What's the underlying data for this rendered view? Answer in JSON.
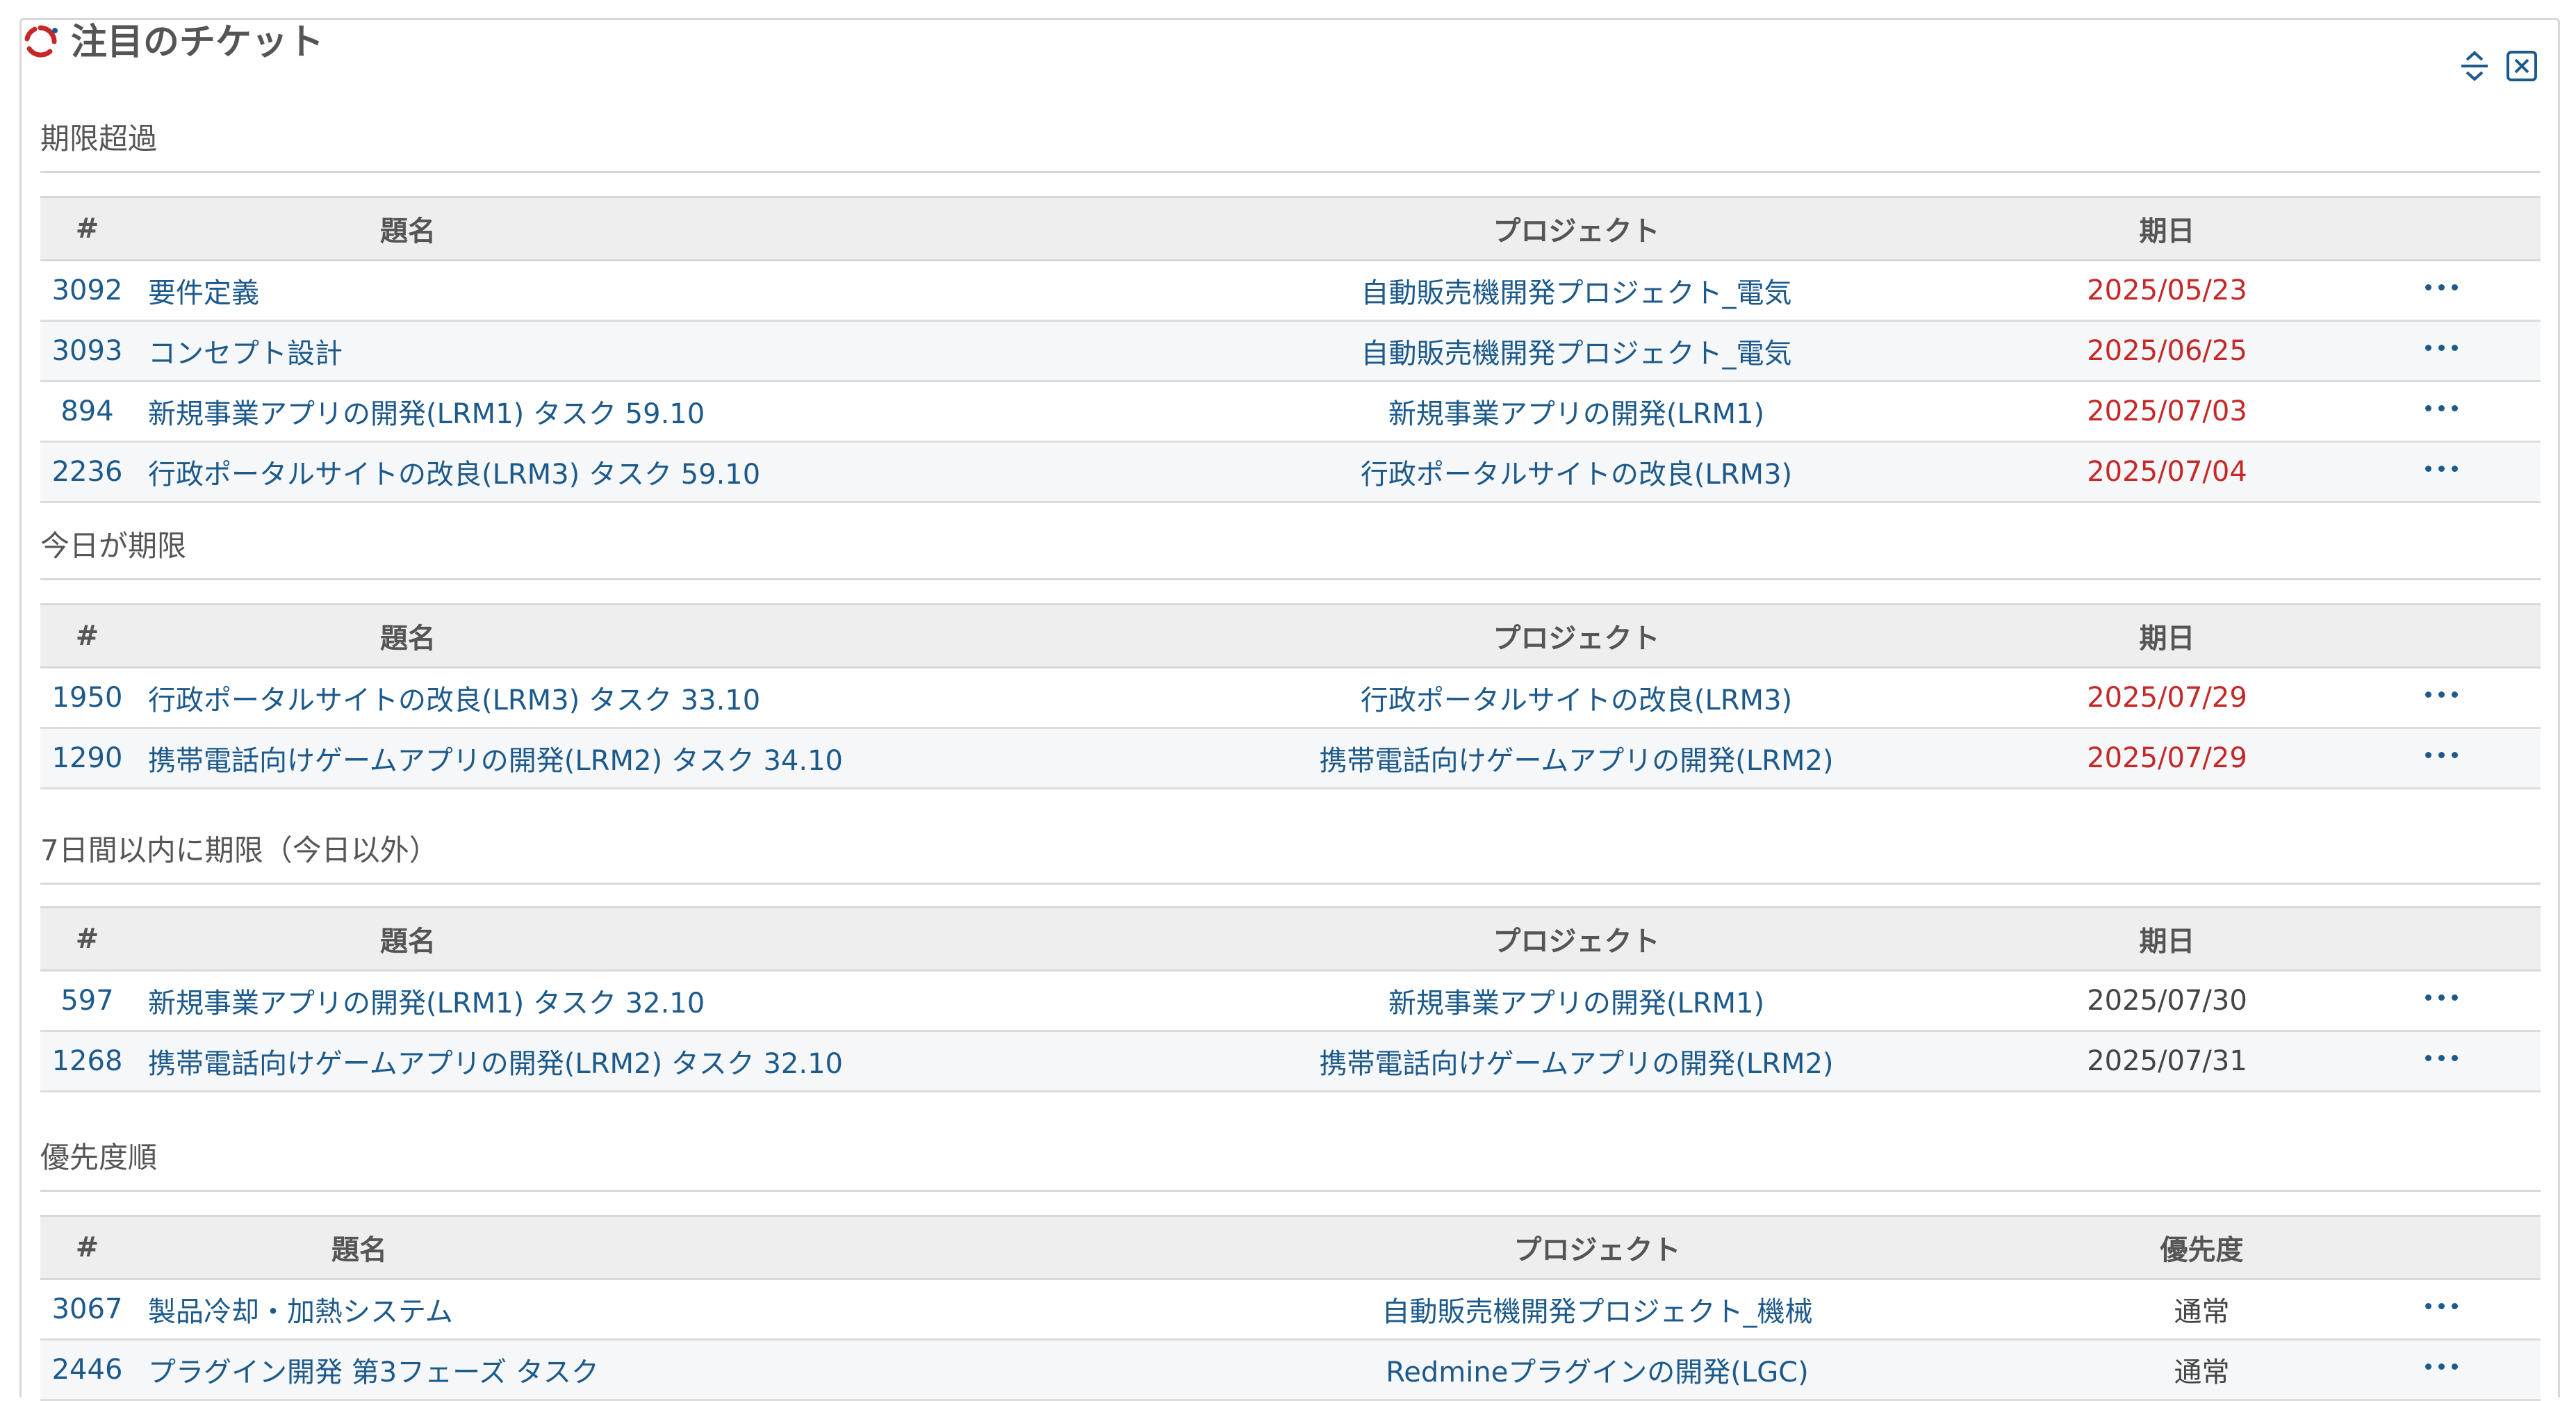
{
  "widget": {
    "title": "注目のチケット",
    "collapse_icon": "collapse-icon",
    "close_icon": "close-icon",
    "logo_colors": [
      "#c62828",
      "#1d5a8c"
    ]
  },
  "columns": {
    "id": "#",
    "subject": "題名",
    "project": "プロジェクト",
    "due": "期日",
    "priority": "優先度"
  },
  "sections": [
    {
      "title": "期限超過",
      "rows": [
        {
          "id": "3092",
          "subject": "要件定義",
          "project": "自動販売機開発プロジェクト_電気",
          "due": "2025/05/23"
        },
        {
          "id": "3093",
          "subject": "コンセプト設計",
          "project": "自動販売機開発プロジェクト_電気",
          "due": "2025/06/25"
        },
        {
          "id": "894",
          "subject": "新規事業アプリの開発(LRM1) タスク 59.10",
          "project": "新規事業アプリの開発(LRM1)",
          "due": "2025/07/03"
        },
        {
          "id": "2236",
          "subject": "行政ポータルサイトの改良(LRM3) タスク 59.10",
          "project": "行政ポータルサイトの改良(LRM3)",
          "due": "2025/07/04"
        }
      ]
    },
    {
      "title": "今日が期限",
      "rows": [
        {
          "id": "1950",
          "subject": "行政ポータルサイトの改良(LRM3) タスク 33.10",
          "project": "行政ポータルサイトの改良(LRM3)",
          "due": "2025/07/29"
        },
        {
          "id": "1290",
          "subject": "携帯電話向けゲームアプリの開発(LRM2) タスク 34.10",
          "project": "携帯電話向けゲームアプリの開発(LRM2)",
          "due": "2025/07/29"
        }
      ]
    },
    {
      "title": "7日間以内に期限（今日以外）",
      "rows": [
        {
          "id": "597",
          "subject": "新規事業アプリの開発(LRM1) タスク 32.10",
          "project": "新規事業アプリの開発(LRM1)",
          "due": "2025/07/30"
        },
        {
          "id": "1268",
          "subject": "携帯電話向けゲームアプリの開発(LRM2) タスク 32.10",
          "project": "携帯電話向けゲームアプリの開発(LRM2)",
          "due": "2025/07/31"
        }
      ]
    },
    {
      "title": "優先度順",
      "rows": [
        {
          "id": "3067",
          "subject": "製品冷却・加熱システム",
          "project": "自動販売機開発プロジェクト_機械",
          "priority": "通常"
        },
        {
          "id": "2446",
          "subject": "プラグイン開発 第3フェーズ タスク",
          "project": "Redmineプラグインの開発(LGC)",
          "priority": "通常"
        }
      ]
    }
  ],
  "colors": {
    "link": "#1d5a8c",
    "overdue": "#c62828",
    "header_bg": "#eeeeee",
    "border": "#d8d8d8"
  }
}
